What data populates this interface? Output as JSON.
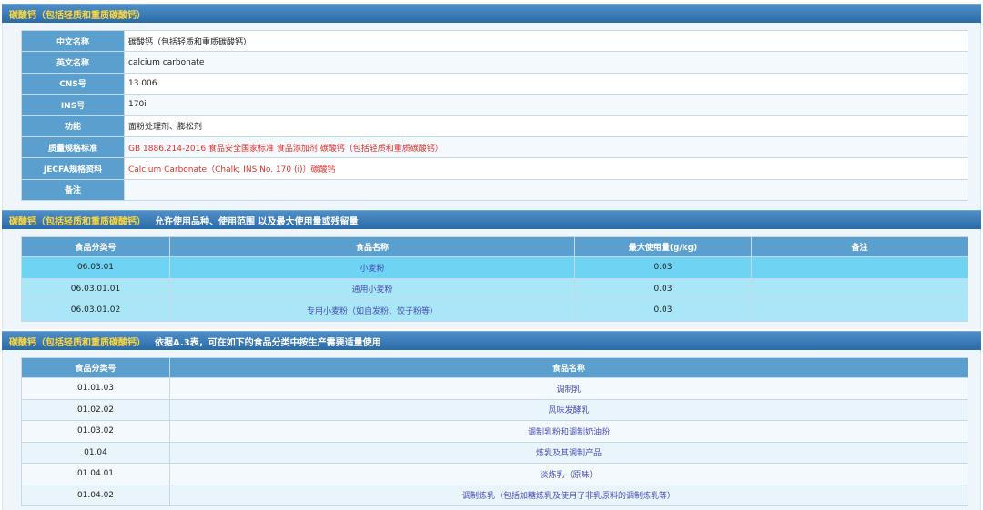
{
  "sections": {
    "info_title": "碳酸钙（包括轻质和重质碳酸钙）",
    "usage_title": "碳酸钙（包括轻质和重质碳酸钙）",
    "usage_subtitle": "允许使用品种、使用范围 以及最大使用量或残留量",
    "list_title": "碳酸钙（包括轻质和重质碳酸钙）",
    "list_subtitle": "依据A.3表，可在如下的食品分类中按生产需要适量使用"
  },
  "info": {
    "rows": [
      {
        "key": "中文名称",
        "value": "碳酸钙（包括轻质和重质碳酸钙）"
      },
      {
        "key": "英文名称",
        "value": "calcium carbonate"
      },
      {
        "key": "CNS号",
        "value": "13.006"
      },
      {
        "key": "INS号",
        "value": "170i"
      },
      {
        "key": "功能",
        "value": "面粉处理剂、膨松剂"
      },
      {
        "key": "质量规格标准",
        "value": "GB 1886.214-2016 食品安全国家标准 食品添加剂 碳酸钙（包括轻质和重质碳酸钙）"
      },
      {
        "key": "JECFA规格资料",
        "value": "Calcium Carbonate（Chalk; INS No. 170 (i)）碳酸钙"
      },
      {
        "key": "备注",
        "value": ""
      }
    ]
  },
  "usage": {
    "headers": [
      "食品分类号",
      "食品名称",
      "最大使用量(g/kg)",
      "备注"
    ],
    "rows": [
      {
        "code": "06.03.01",
        "name": "小麦粉",
        "max": "0.03",
        "note": ""
      },
      {
        "code": "06.03.01.01",
        "name": "通用小麦粉",
        "max": "0.03",
        "note": ""
      },
      {
        "code": "06.03.01.02",
        "name": "专用小麦粉（如自发粉、饺子粉等）",
        "max": "0.03",
        "note": ""
      }
    ]
  },
  "list": {
    "headers": [
      "食品分类号",
      "食品名称"
    ],
    "rows": [
      {
        "code": "01.01.03",
        "name": "调制乳"
      },
      {
        "code": "01.02.02",
        "name": "风味发酵乳"
      },
      {
        "code": "01.03.02",
        "name": "调制乳粉和调制奶油粉"
      },
      {
        "code": "01.04",
        "name": "炼乳及其调制产品"
      },
      {
        "code": "01.04.01",
        "name": "淡炼乳（原味）"
      },
      {
        "code": "01.04.02",
        "name": "调制炼乳（包括加糖炼乳及使用了非乳原料的调制炼乳等）"
      }
    ]
  }
}
